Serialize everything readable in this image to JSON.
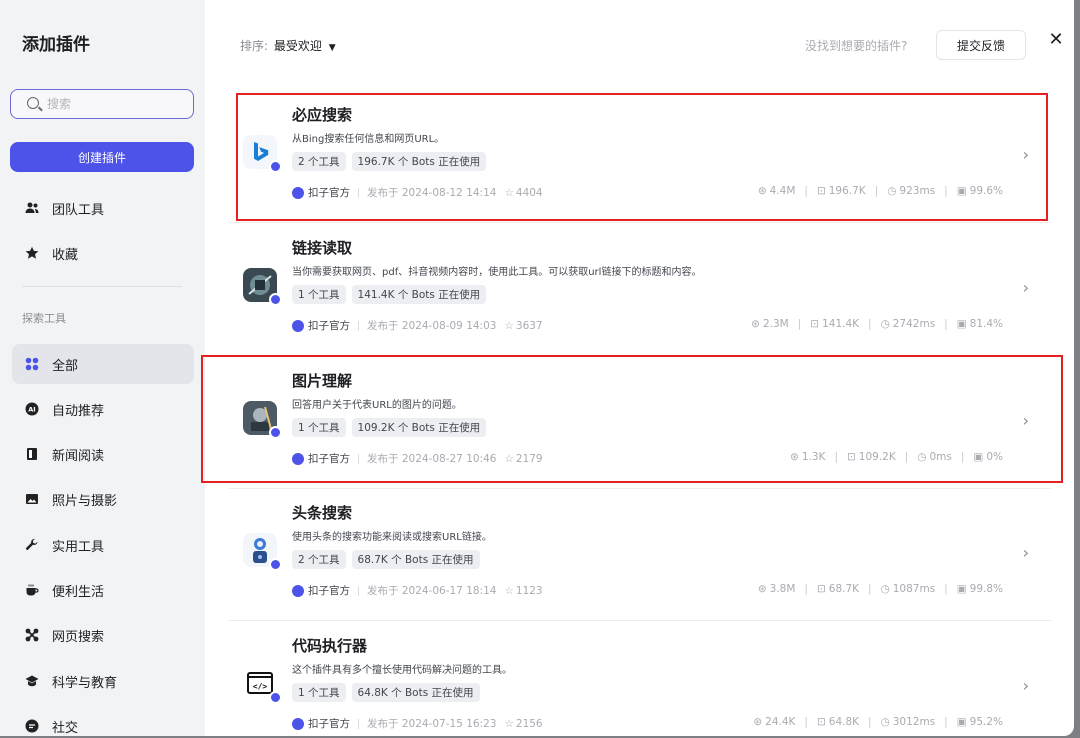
{
  "sidebar": {
    "title": "添加插件",
    "search_placeholder": "搜索",
    "create_button": "创建插件",
    "top_items": [
      {
        "label": "团队工具",
        "icon": "team-icon"
      },
      {
        "label": "收藏",
        "icon": "star-icon"
      }
    ],
    "section_label": "探索工具",
    "categories": [
      {
        "label": "全部",
        "icon": "grid-icon",
        "active": true
      },
      {
        "label": "自动推荐",
        "icon": "ai-icon"
      },
      {
        "label": "新闻阅读",
        "icon": "news-icon"
      },
      {
        "label": "照片与摄影",
        "icon": "photo-icon"
      },
      {
        "label": "实用工具",
        "icon": "wrench-icon"
      },
      {
        "label": "便利生活",
        "icon": "cup-icon"
      },
      {
        "label": "网页搜索",
        "icon": "web-search-icon"
      },
      {
        "label": "科学与教育",
        "icon": "education-icon"
      },
      {
        "label": "社交",
        "icon": "social-icon"
      }
    ]
  },
  "header": {
    "sort_label": "排序:",
    "sort_value": "最受欢迎",
    "not_found_text": "没找到想要的插件?",
    "feedback_button": "提交反馈",
    "close_label": "✕"
  },
  "plugins": [
    {
      "name": "必应搜索",
      "description": "从Bing搜索任何信息和网页URL。",
      "tools": "2 个工具",
      "bots": "196.7K 个 Bots 正在使用",
      "author": "扣子官方",
      "published": "发布于 2024-08-12 14:14",
      "favorites": "4404",
      "calls": "4.4M",
      "bots_count": "196.7K",
      "latency": "923ms",
      "success_rate": "99.6%",
      "icon": "bing-icon",
      "highlighted": true
    },
    {
      "name": "链接读取",
      "description": "当你需要获取网页、pdf、抖音视频内容时，使用此工具。可以获取url链接下的标题和内容。",
      "tools": "1 个工具",
      "bots": "141.4K 个 Bots 正在使用",
      "author": "扣子官方",
      "published": "发布于 2024-08-09 14:03",
      "favorites": "3637",
      "calls": "2.3M",
      "bots_count": "141.4K",
      "latency": "2742ms",
      "success_rate": "81.4%",
      "icon": "link-reader-icon",
      "highlighted": false
    },
    {
      "name": "图片理解",
      "description": "回答用户关于代表URL的图片的问题。",
      "tools": "1 个工具",
      "bots": "109.2K 个 Bots 正在使用",
      "author": "扣子官方",
      "published": "发布于 2024-08-27 10:46",
      "favorites": "2179",
      "calls": "1.3K",
      "bots_count": "109.2K",
      "latency": "0ms",
      "success_rate": "0%",
      "icon": "image-understanding-icon",
      "highlighted": true
    },
    {
      "name": "头条搜索",
      "description": "使用头条的搜索功能来阅读或搜索URL链接。",
      "tools": "2 个工具",
      "bots": "68.7K 个 Bots 正在使用",
      "author": "扣子官方",
      "published": "发布于 2024-06-17 18:14",
      "favorites": "1123",
      "calls": "3.8M",
      "bots_count": "68.7K",
      "latency": "1087ms",
      "success_rate": "99.8%",
      "icon": "toutiao-icon",
      "highlighted": false
    },
    {
      "name": "代码执行器",
      "description": "这个插件具有多个擅长使用代码解决问题的工具。",
      "tools": "1 个工具",
      "bots": "64.8K 个 Bots 正在使用",
      "author": "扣子官方",
      "published": "发布于 2024-07-15 16:23",
      "favorites": "2156",
      "calls": "24.4K",
      "bots_count": "64.8K",
      "latency": "3012ms",
      "success_rate": "95.2%",
      "icon": "code-icon",
      "highlighted": false
    }
  ],
  "colors": {
    "accent": "#4d53e8",
    "highlight_box": "#e52020"
  }
}
